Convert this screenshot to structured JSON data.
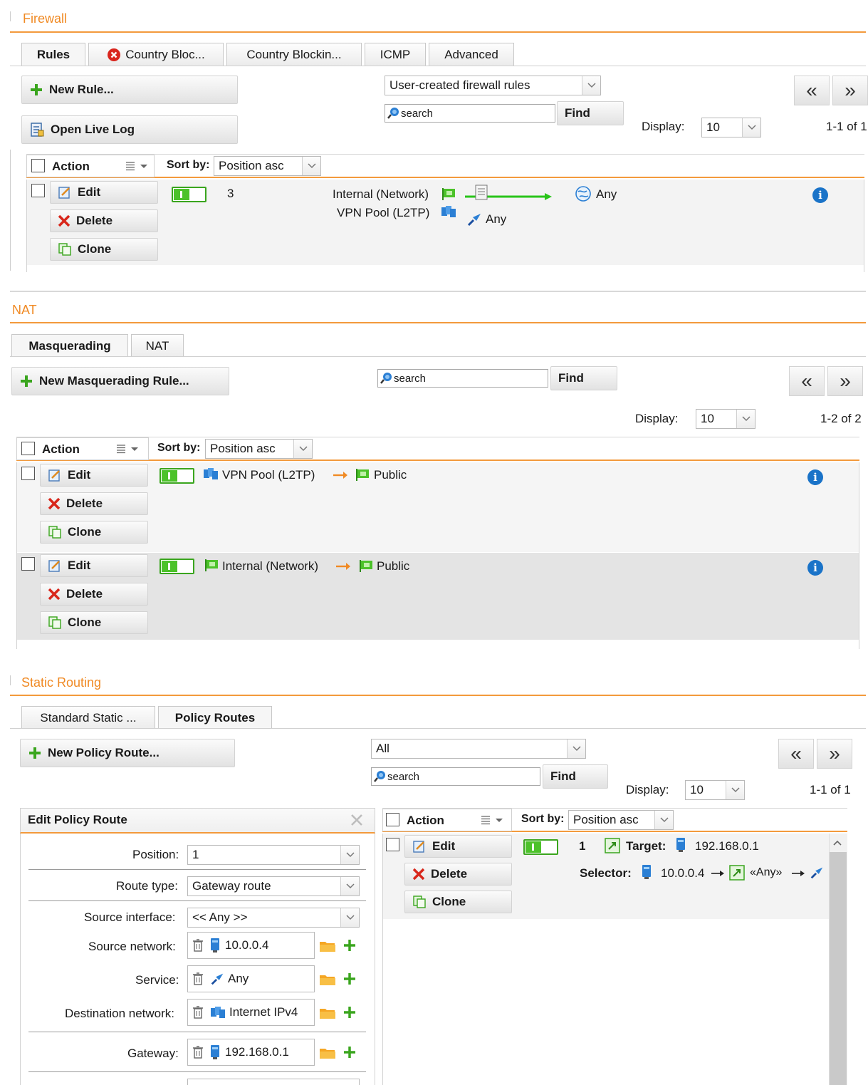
{
  "firewall": {
    "title": "Firewall",
    "tabs": [
      "Rules",
      "Country Bloc...",
      "Country Blockin...",
      "ICMP",
      "Advanced"
    ],
    "new_rule": "New Rule...",
    "open_live_log": "Open Live Log",
    "filter_select": "User-created firewall rules",
    "search_placeholder": "search",
    "find": "Find",
    "display_label": "Display:",
    "display_value": "10",
    "pager_text": "1-1 of 1",
    "action_header": "Action",
    "sort_by_label": "Sort by:",
    "sort_value": "Position asc",
    "row": {
      "edit": "Edit",
      "delete": "Delete",
      "clone": "Clone",
      "position": "3",
      "source1": "Internal (Network)",
      "source2": "VPN Pool (L2TP)",
      "destination": "Any",
      "service": "Any"
    }
  },
  "nat": {
    "title": "NAT",
    "tabs": [
      "Masquerading",
      "NAT"
    ],
    "new_rule": "New Masquerading Rule...",
    "search_placeholder": "search",
    "find": "Find",
    "display_label": "Display:",
    "display_value": "10",
    "pager_text": "1-2 of 2",
    "action_header": "Action",
    "sort_by_label": "Sort by:",
    "sort_value": "Position asc",
    "rows": [
      {
        "edit": "Edit",
        "delete": "Delete",
        "clone": "Clone",
        "network": "VPN Pool (L2TP)",
        "interface": "Public"
      },
      {
        "edit": "Edit",
        "delete": "Delete",
        "clone": "Clone",
        "network": "Internal (Network)",
        "interface": "Public"
      }
    ]
  },
  "static_routing": {
    "title": "Static Routing",
    "tabs": [
      "Standard Static ...",
      "Policy Routes"
    ],
    "new_route": "New Policy Route...",
    "filter_select": "All",
    "search_placeholder": "search",
    "find": "Find",
    "display_label": "Display:",
    "display_value": "10",
    "pager_text": "1-1 of 1",
    "edit_panel": {
      "title": "Edit Policy Route",
      "position_label": "Position:",
      "position_value": "1",
      "route_type_label": "Route type:",
      "route_type_value": "Gateway route",
      "source_interface_label": "Source interface:",
      "source_interface_value": "<< Any >>",
      "source_network_label": "Source network:",
      "source_network_value": "10.0.0.4",
      "service_label": "Service:",
      "service_value": "Any",
      "destination_network_label": "Destination network:",
      "destination_network_value": "Internet IPv4",
      "gateway_label": "Gateway:",
      "gateway_value": "192.168.0.1"
    },
    "list": {
      "action_header": "Action",
      "sort_by_label": "Sort by:",
      "sort_value": "Position asc",
      "row": {
        "edit": "Edit",
        "delete": "Delete",
        "clone": "Clone",
        "position": "1",
        "target_label": "Target:",
        "target_value": "192.168.0.1",
        "selector_label": "Selector:",
        "selector_source": "10.0.0.4",
        "selector_service": "«Any»"
      }
    }
  }
}
